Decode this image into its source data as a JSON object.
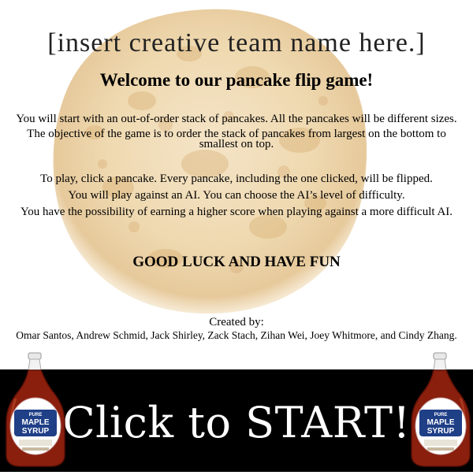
{
  "intro": {
    "team_name": "[insert creative team name here.]",
    "welcome": "Welcome to our pancake flip game!",
    "paragraph1": "You will start with an out-of-order stack of pancakes. All the pancakes will be different sizes.",
    "paragraph2": "The objective of the game is to order the stack of pancakes from largest on the bottom to smallest on top.",
    "paragraph3": "To play, click a pancake. Every pancake, including the one clicked, will be flipped.",
    "paragraph4": "You will play against an AI. You can choose the AI’s level of difficulty.",
    "paragraph5": "You have the possibility of earning a higher score when playing against a more difficult AI.",
    "good_luck": "GOOD LUCK AND HAVE FUN",
    "created_by_label": "Created by:",
    "authors": "Omar Santos, Andrew Schmid, Jack Shirley, Zack Stach, Zihan Wei, Joey Whitmore, and Cindy Zhang."
  },
  "start_button": {
    "label": "Click to START!"
  },
  "decor": {
    "background_image": "pancake",
    "bottle_icon": "maple-syrup-bottle-icon",
    "bottle_label_top": "PURE",
    "bottle_label_mid1": "MAPLE",
    "bottle_label_mid2": "SYRUP",
    "colors": {
      "pancake_light": "#f3e3c4",
      "pancake_dark": "#d9b27a",
      "syrup": "#8a1f0e",
      "label_blue": "#1f3f87",
      "start_bar": "#000000",
      "start_text": "#ffffff"
    }
  }
}
